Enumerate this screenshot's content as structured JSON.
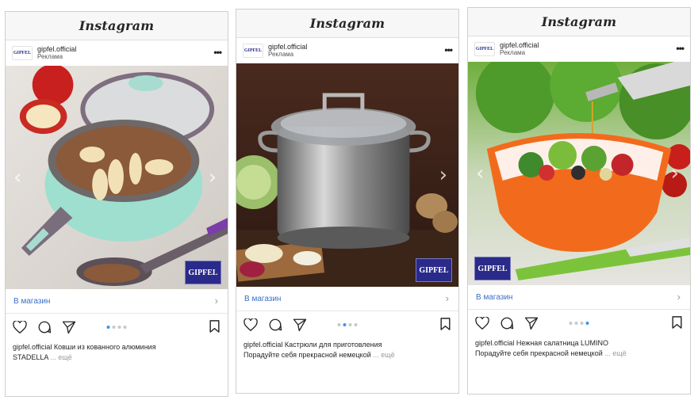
{
  "platform": "Instagram",
  "cards": [
    {
      "account": "gipfel.official",
      "sponsored": "Реклама",
      "avatar_text": "GIPFEL",
      "badge_text": "GIPFEL",
      "shop_label": "В магазин",
      "caption_account": "gipfel.official",
      "caption_line1": "Ковши из кованного алюминия",
      "caption_line2": "STADELLA",
      "more_label": "... ещё",
      "carousel": {
        "count": 4,
        "active": 0
      }
    },
    {
      "account": "gipfel.official",
      "sponsored": "Реклама",
      "avatar_text": "GIPFEL",
      "badge_text": "GIPFEL",
      "shop_label": "В магазин",
      "caption_account": "gipfel.official",
      "caption_line1": "Кастрюли для приготовления",
      "caption_line2": "Порадуйте себя прекрасной немецкой",
      "more_label": "... ещё",
      "carousel": {
        "count": 4,
        "active": 1
      }
    },
    {
      "account": "gipfel.official",
      "sponsored": "Реклама",
      "avatar_text": "GIPFEL",
      "badge_text": "GIPFEL",
      "shop_label": "В магазин",
      "caption_account": "gipfel.official",
      "caption_line1": "Нежная салатница LUMINO",
      "caption_line2": "Порадуйте себя прекрасной немецкой",
      "more_label": "... ещё",
      "carousel": {
        "count": 4,
        "active": 3
      }
    }
  ],
  "icons": {
    "like": "heart-icon",
    "comment": "comment-icon",
    "share": "share-icon",
    "save": "bookmark-icon",
    "more": "more-options-icon"
  },
  "colors": {
    "link": "#3a6fc7",
    "dot_active": "#3897f0",
    "dot_inactive": "#c8c8c8",
    "brand_badge": "#2a2a8a"
  }
}
